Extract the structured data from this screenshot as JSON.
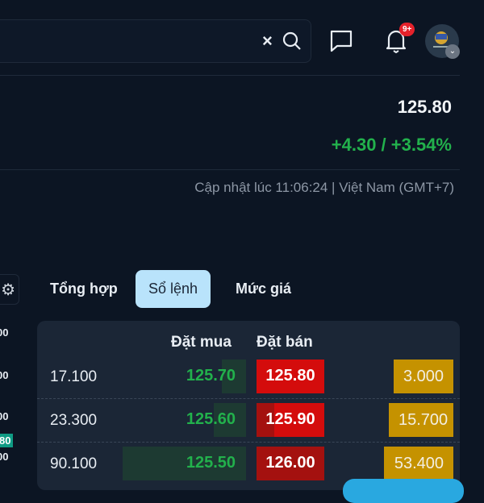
{
  "header": {
    "clear_label": "×",
    "notification_count": "9+"
  },
  "quote": {
    "price": "125.80",
    "change": "+4.30 / +3.54%",
    "updated": "Cập nhật lúc 11:06:24 | Việt Nam (GMT+7)"
  },
  "chart_axis_partial": [
    "00",
    "00",
    "00",
    "80",
    "00"
  ],
  "tabs": [
    {
      "label": "Tổng hợp"
    },
    {
      "label": "Sổ lệnh"
    },
    {
      "label": "Mức giá"
    }
  ],
  "orderbook": {
    "headers": {
      "bid": "Đặt mua",
      "ask": "Đặt bán"
    },
    "rows": [
      {
        "bid_volume": "17.100",
        "bid_price": "125.70",
        "ask_price": "125.80",
        "ask_volume": "3.000"
      },
      {
        "bid_volume": "23.300",
        "bid_price": "125.60",
        "ask_price": "125.90",
        "ask_volume": "15.700"
      },
      {
        "bid_volume": "90.100",
        "bid_price": "125.50",
        "ask_price": "126.00",
        "ask_volume": "53.400"
      }
    ]
  }
}
